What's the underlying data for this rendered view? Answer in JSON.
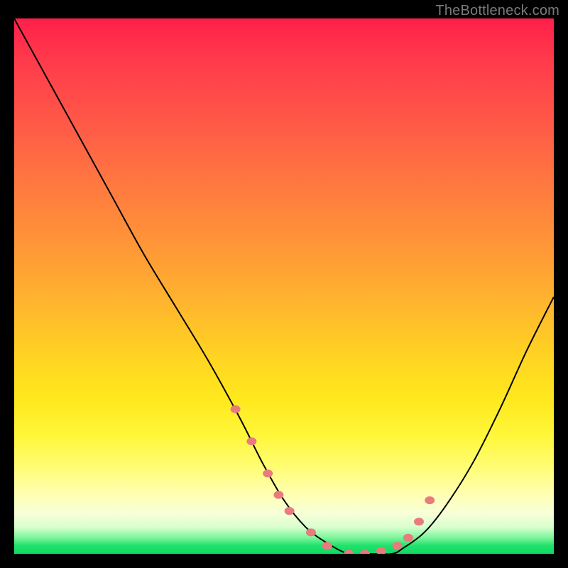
{
  "watermark": "TheBottleneck.com",
  "chart_data": {
    "type": "line",
    "title": "",
    "xlabel": "",
    "ylabel": "",
    "xlim": [
      0,
      100
    ],
    "ylim": [
      0,
      100
    ],
    "grid": false,
    "legend": false,
    "series": [
      {
        "name": "bottleneck-curve",
        "x": [
          0,
          6,
          12,
          18,
          24,
          30,
          36,
          42,
          46,
          50,
          54,
          58,
          62,
          66,
          70,
          72,
          76,
          80,
          85,
          90,
          95,
          100
        ],
        "y": [
          100,
          89,
          78,
          67,
          56,
          46,
          36,
          25,
          17,
          10,
          5,
          2,
          0,
          0,
          0,
          1,
          4,
          9,
          17,
          27,
          38,
          48
        ]
      }
    ],
    "markers": {
      "name": "highlighted-points",
      "color": "#e97a7d",
      "x": [
        41,
        44,
        47,
        49,
        51,
        55,
        58,
        62,
        65,
        68,
        71,
        73,
        75,
        77
      ],
      "y": [
        27,
        21,
        15,
        11,
        8,
        4,
        1.5,
        0,
        0,
        0.5,
        1.5,
        3,
        6,
        10
      ]
    },
    "background_gradient": {
      "top": "#ff1f4a",
      "mid1": "#ff9a36",
      "mid2": "#fff73a",
      "pale": "#ffffb4",
      "bottom": "#0fd964"
    }
  }
}
